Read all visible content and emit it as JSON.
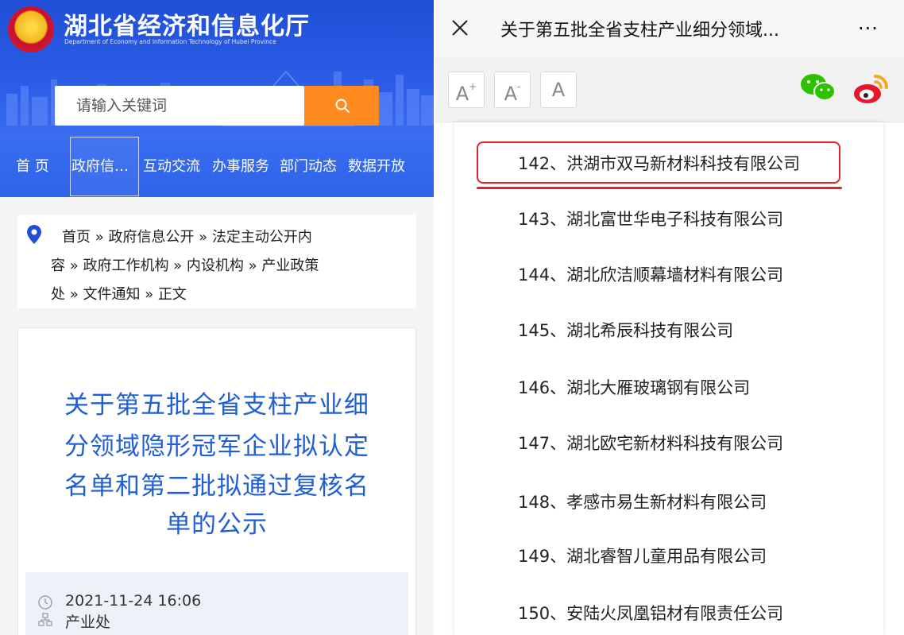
{
  "left": {
    "site_title": "湖北省经济和信息化厅",
    "site_subtitle": "Department of Economy and Information Technology of Hubei Province",
    "search": {
      "placeholder": "请输入关键词"
    },
    "nav": [
      "首 页",
      "政府信…",
      "互动交流",
      "办事服务",
      "部门动态",
      "数据开放"
    ],
    "breadcrumb": {
      "line1": "首页 » 政府信息公开 » 法定主动公开内",
      "line2": "容 » 政府工作机构 » 内设机构 » 产业政策",
      "line3": "处 » 文件通知 » 正文"
    },
    "article": {
      "title_lines": [
        "关于第五批全省支柱产业细",
        "分领域隐形冠军企业拟认定",
        "名单和第二批拟通过复核名",
        "单的公示"
      ],
      "date": "2021-11-24 16:06",
      "department": "产业处"
    }
  },
  "right": {
    "page_title": "关于第五批全省支柱产业细分领域...",
    "more": "···",
    "font_buttons": [
      "A",
      "A",
      "A"
    ],
    "items": [
      "142、洪湖市双马新材料科技有限公司",
      "143、湖北富世华电子科技有限公司",
      "144、湖北欣洁顺幕墙材料有限公司",
      "145、湖北希辰科技有限公司",
      "146、湖北大雁玻璃钢有限公司",
      "147、湖北欧宅新材料科技有限公司",
      "148、孝感市易生新材料有限公司",
      "149、湖北睿智儿童用品有限公司",
      "150、安陆火凤凰铝材有限责任公司"
    ]
  },
  "colors": {
    "brand_blue": "#2c5ee8",
    "title_blue": "#1f5fd6",
    "search_orange": "#ff8a1f",
    "highlight_red": "#e2232a",
    "wechat_green": "#2dc100",
    "weibo_orange": "#f5a623"
  }
}
